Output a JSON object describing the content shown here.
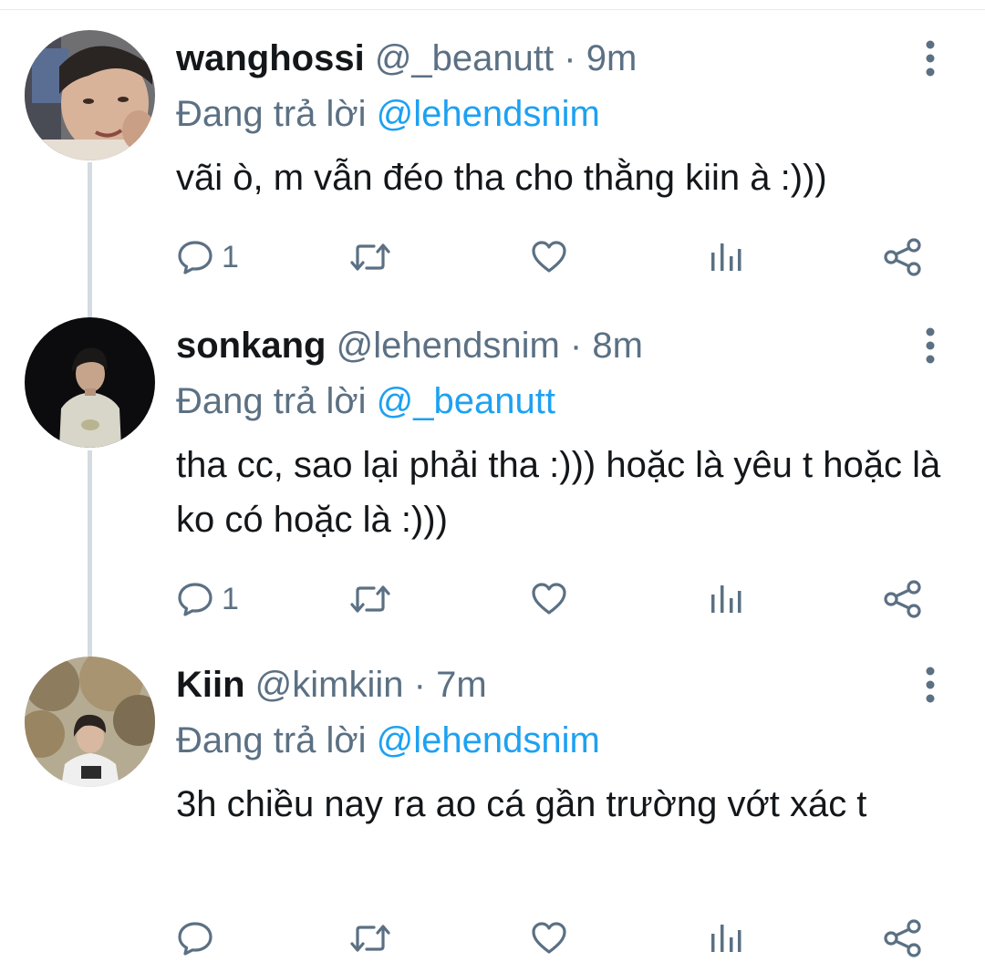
{
  "tweets": [
    {
      "name": "wanghossi",
      "handle": "@_beanutt",
      "separator": "·",
      "time": "9m",
      "reply_prefix": "Đang trả lời",
      "reply_to": "@lehendsnim",
      "text": "vãi ò, m vẫn đéo tha cho thằng kiin à :)))",
      "reply_count": "1",
      "avatar_icon": "user-photo-1"
    },
    {
      "name": "sonkang",
      "handle": "@lehendsnim",
      "separator": "·",
      "time": "8m",
      "reply_prefix": "Đang trả lời",
      "reply_to": "@_beanutt",
      "text": "tha cc, sao lại phải tha :))) hoặc là yêu t hoặc là ko có hoặc là :)))",
      "reply_count": "1",
      "avatar_icon": "user-photo-2"
    },
    {
      "name": "Kiin",
      "handle": "@kimkiin",
      "separator": "·",
      "time": "7m",
      "reply_prefix": "Đang trả lời",
      "reply_to": "@lehendsnim",
      "text": "3h chiều nay ra ao cá gần trường vớt xác t",
      "reply_count": "",
      "avatar_icon": "user-photo-3"
    }
  ],
  "icons": {
    "reply": "reply-icon",
    "retweet": "retweet-icon",
    "like": "like-icon",
    "analytics": "analytics-icon",
    "share": "share-icon",
    "more": "more-icon"
  },
  "colors": {
    "mention": "#1da1f2",
    "secondary_text": "#5b7083",
    "primary_text": "#14171a",
    "thread_line": "#d5dbe0"
  }
}
